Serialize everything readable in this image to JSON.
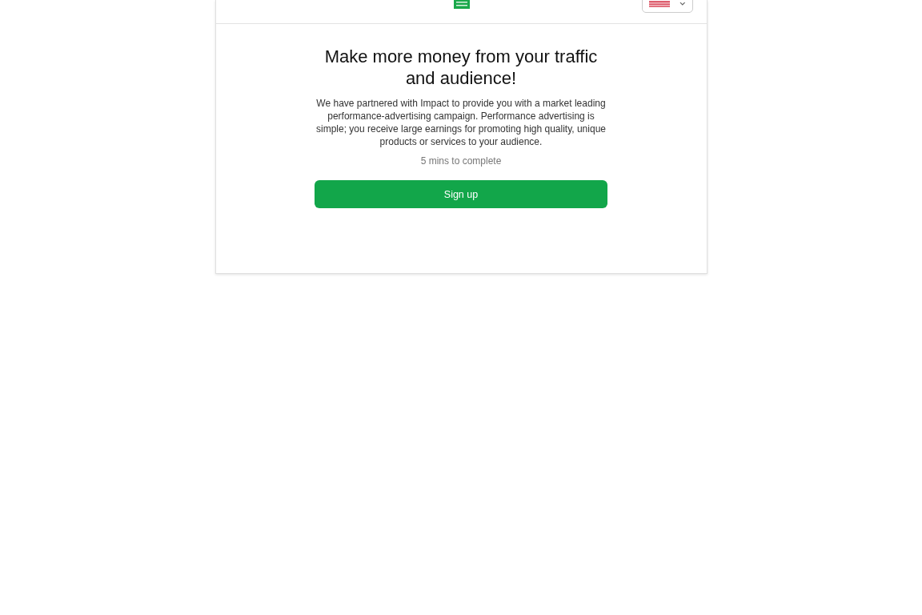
{
  "content": {
    "title": "Make more money from your traffic and audience!",
    "description": "We have partnered with Impact to provide you with a market leading performance-advertising campaign. Performance advertising is simple; you receive large earnings for promoting high quality, unique products or services to your audience.",
    "duration": "5 mins to complete",
    "button": "Sign up"
  }
}
